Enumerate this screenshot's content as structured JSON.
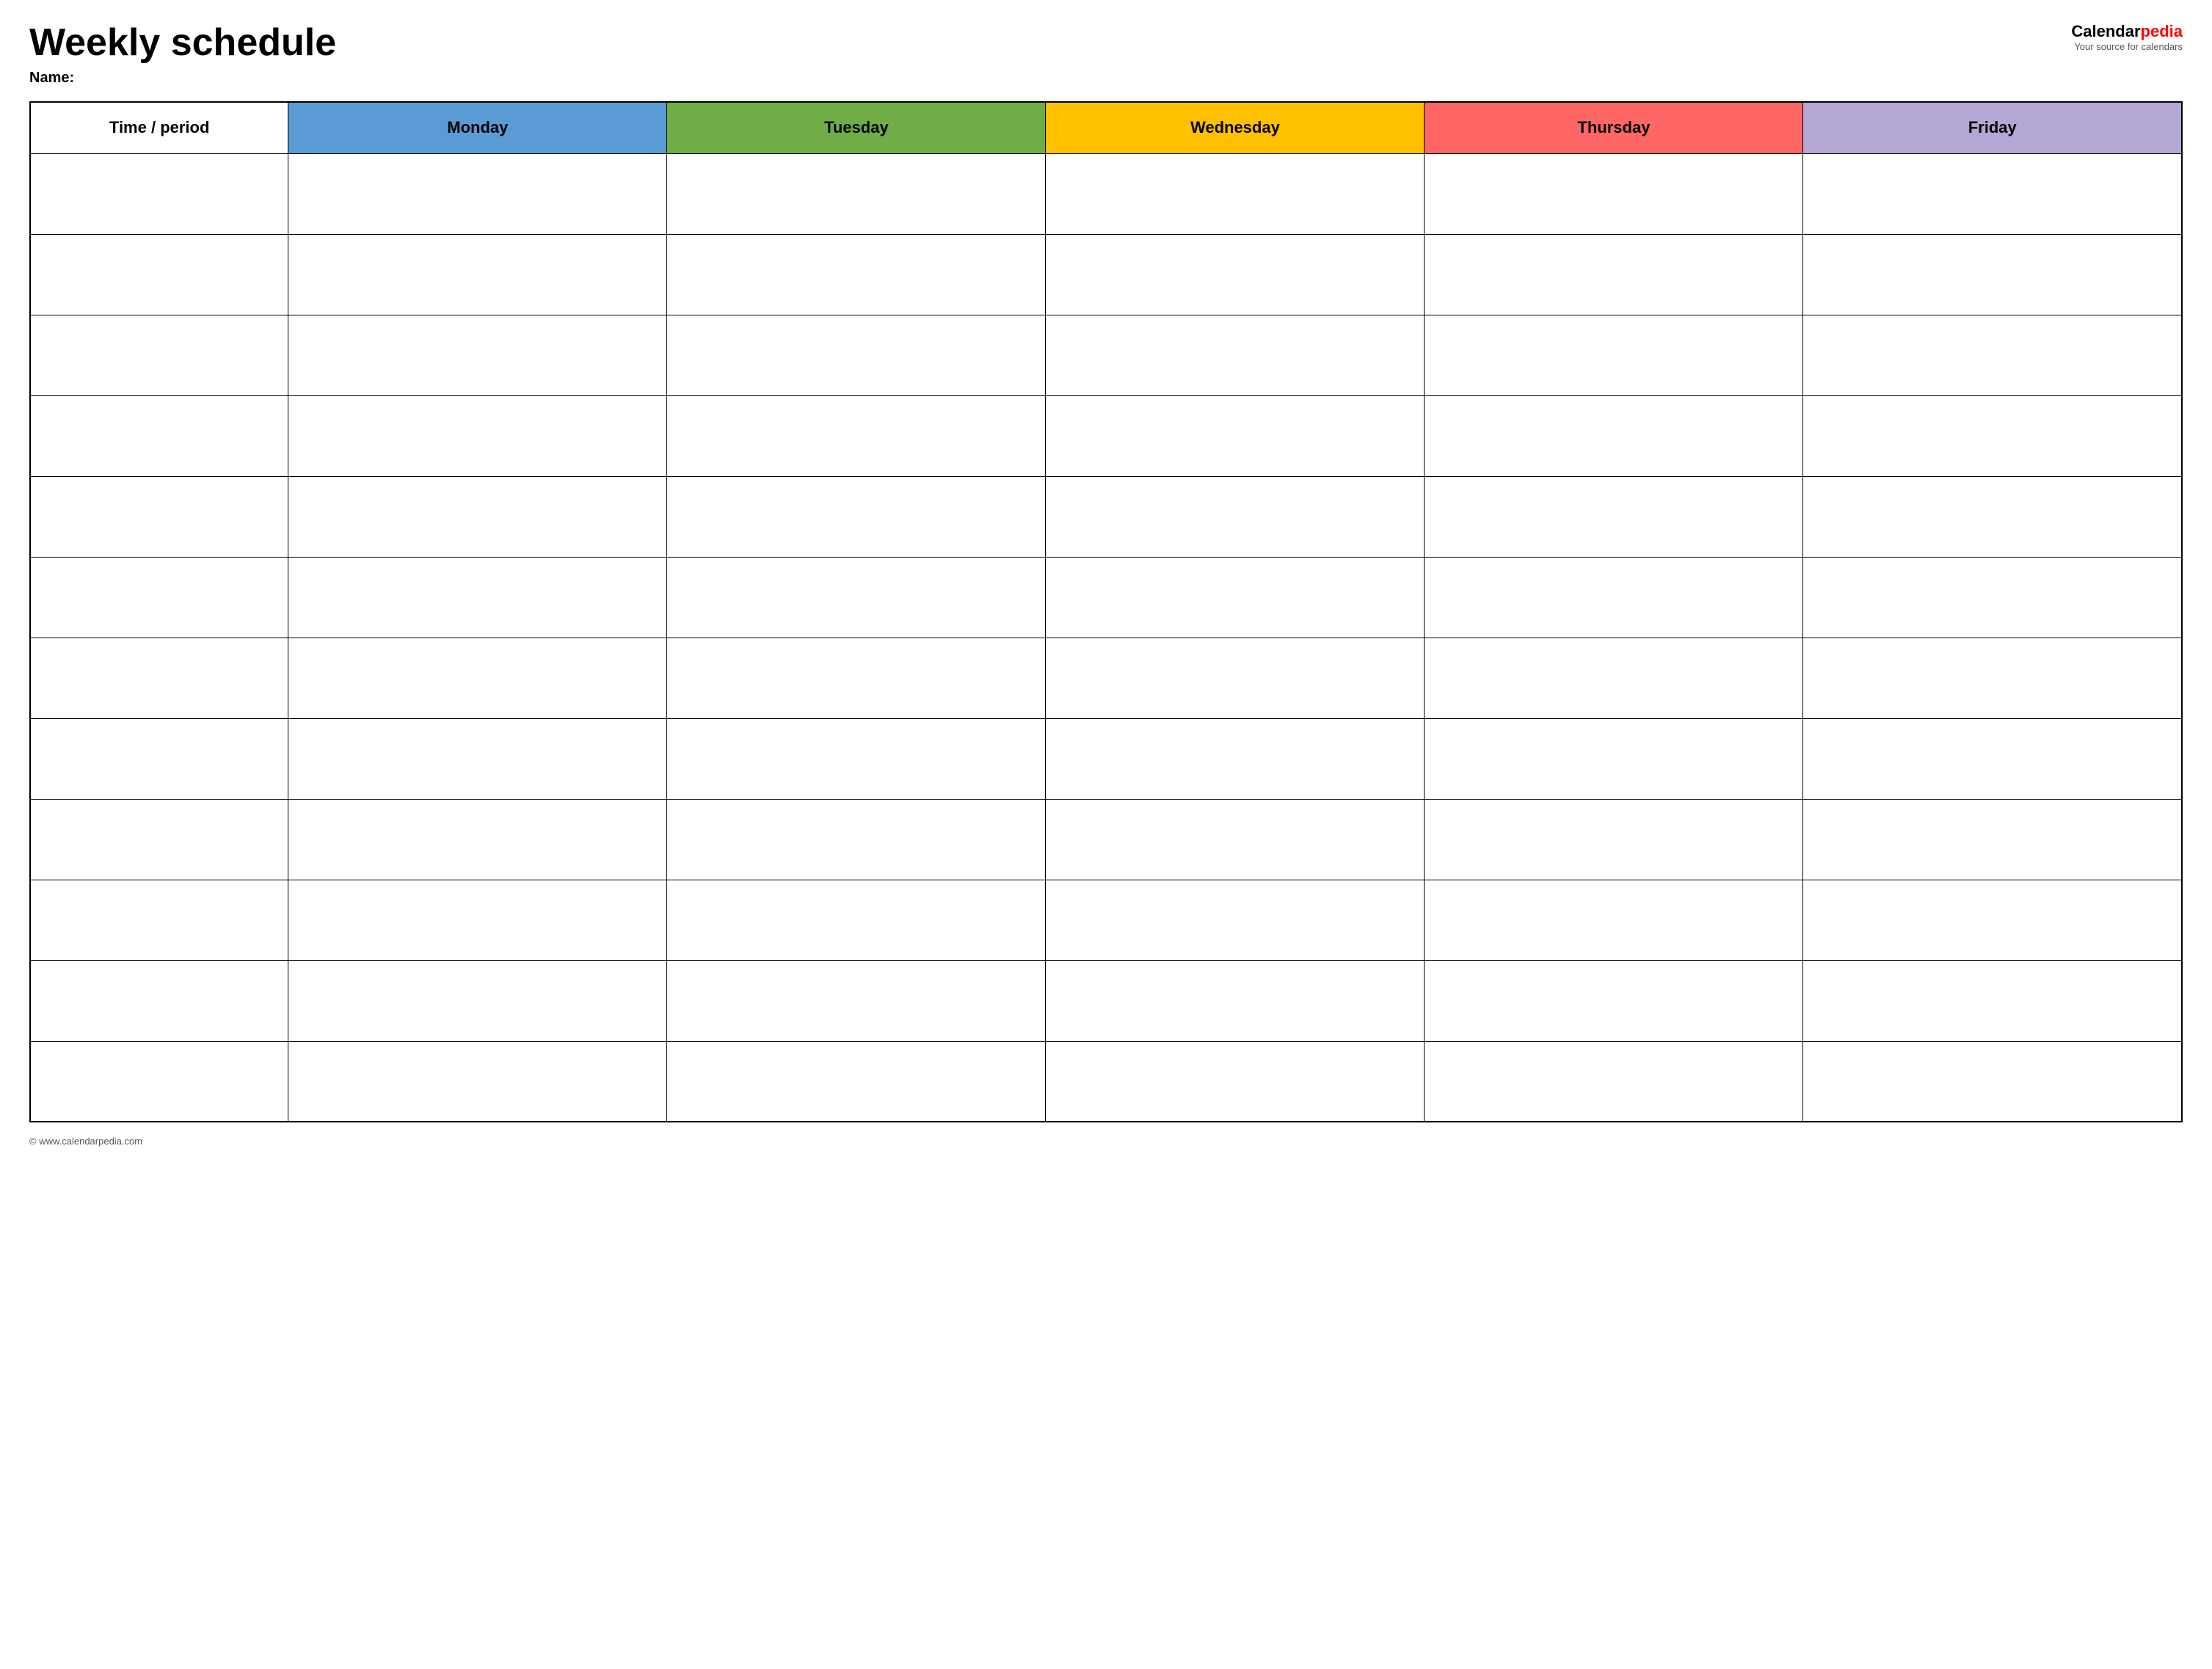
{
  "header": {
    "title": "Weekly schedule",
    "name_label": "Name:",
    "logo_calendar": "Calendar",
    "logo_pedia": "pedia",
    "logo_tagline": "Your source for calendars",
    "website": "© www.calendarpedia.com"
  },
  "table": {
    "columns": [
      {
        "id": "time",
        "label": "Time / period",
        "color": "#ffffff"
      },
      {
        "id": "monday",
        "label": "Monday",
        "color": "#5b9bd5"
      },
      {
        "id": "tuesday",
        "label": "Tuesday",
        "color": "#70ad47"
      },
      {
        "id": "wednesday",
        "label": "Wednesday",
        "color": "#ffc000"
      },
      {
        "id": "thursday",
        "label": "Thursday",
        "color": "#ff6666"
      },
      {
        "id": "friday",
        "label": "Friday",
        "color": "#b4a7d6"
      }
    ],
    "row_count": 12
  }
}
